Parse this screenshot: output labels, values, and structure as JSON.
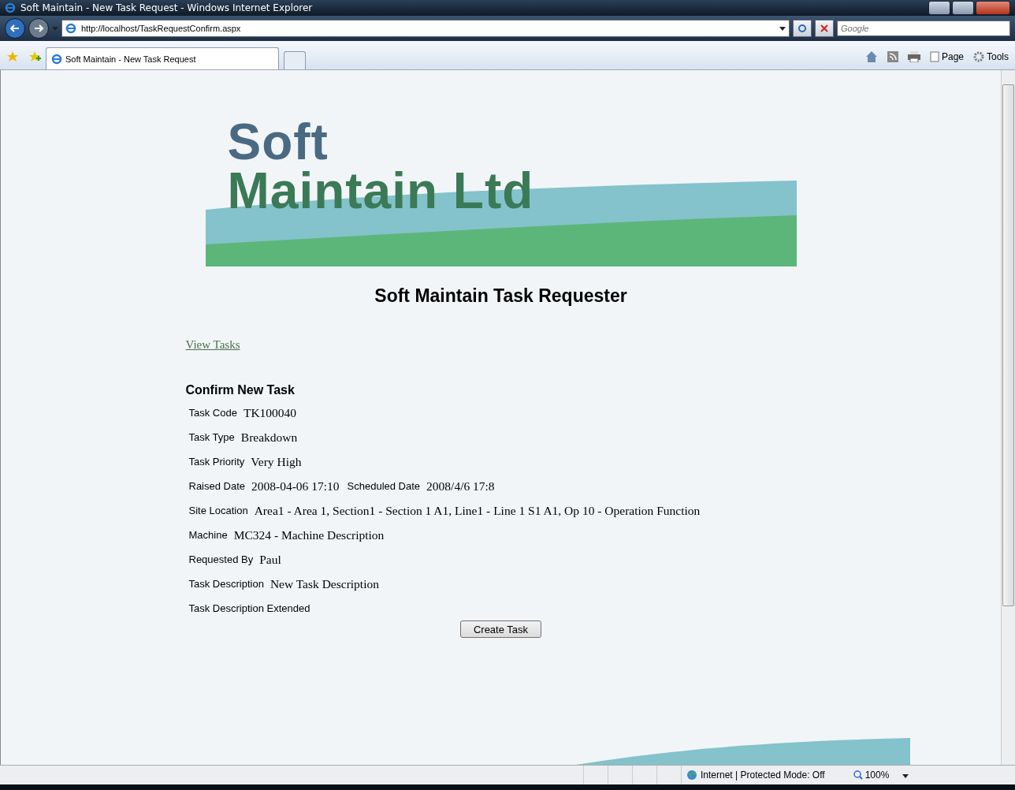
{
  "window": {
    "title": "Soft Maintain - New Task Request - Windows Internet Explorer"
  },
  "address_bar": {
    "url": "http://localhost/TaskRequestConfirm.aspx"
  },
  "search": {
    "placeholder": "Google"
  },
  "tabs": [
    {
      "label": "Soft Maintain - New Task Request",
      "selected": true
    }
  ],
  "command_bar": {
    "page": "Page",
    "tools": "Tools"
  },
  "logo": {
    "line_1": "Soft",
    "line_2": "Maintain Ltd"
  },
  "heading": "Soft Maintain Task Requester",
  "link": "View Tasks",
  "form": {
    "title": "Confirm New Task",
    "rows": [
      [
        {
          "label": "Task Code",
          "value": "TK100040"
        }
      ],
      [
        {
          "label": "Task Type",
          "value": "Breakdown"
        }
      ],
      [
        {
          "label": "Task Priority",
          "value": "Very High"
        }
      ],
      [
        {
          "label": "Raised Date",
          "value": "2008-04-06 17:10"
        },
        {
          "label": "Scheduled Date",
          "value": "2008/4/6 17:8"
        }
      ],
      [
        {
          "label": "Site Location",
          "value": "Area1 - Area 1, Section1 - Section 1 A1, Line1 - Line 1 S1 A1, Op 10 - Operation Function"
        }
      ],
      [
        {
          "label": "Machine",
          "value": "MC324 - Machine Description"
        }
      ],
      [
        {
          "label": "Requested By",
          "value": "Paul"
        }
      ],
      [
        {
          "label": "Task Description",
          "value": "New Task Description"
        }
      ],
      [
        {
          "label": "Task Description Extended"
        }
      ]
    ],
    "button": "Create Task"
  },
  "status_bar": {
    "zone": "Internet | Protected Mode: Off",
    "zoom": "100%"
  }
}
